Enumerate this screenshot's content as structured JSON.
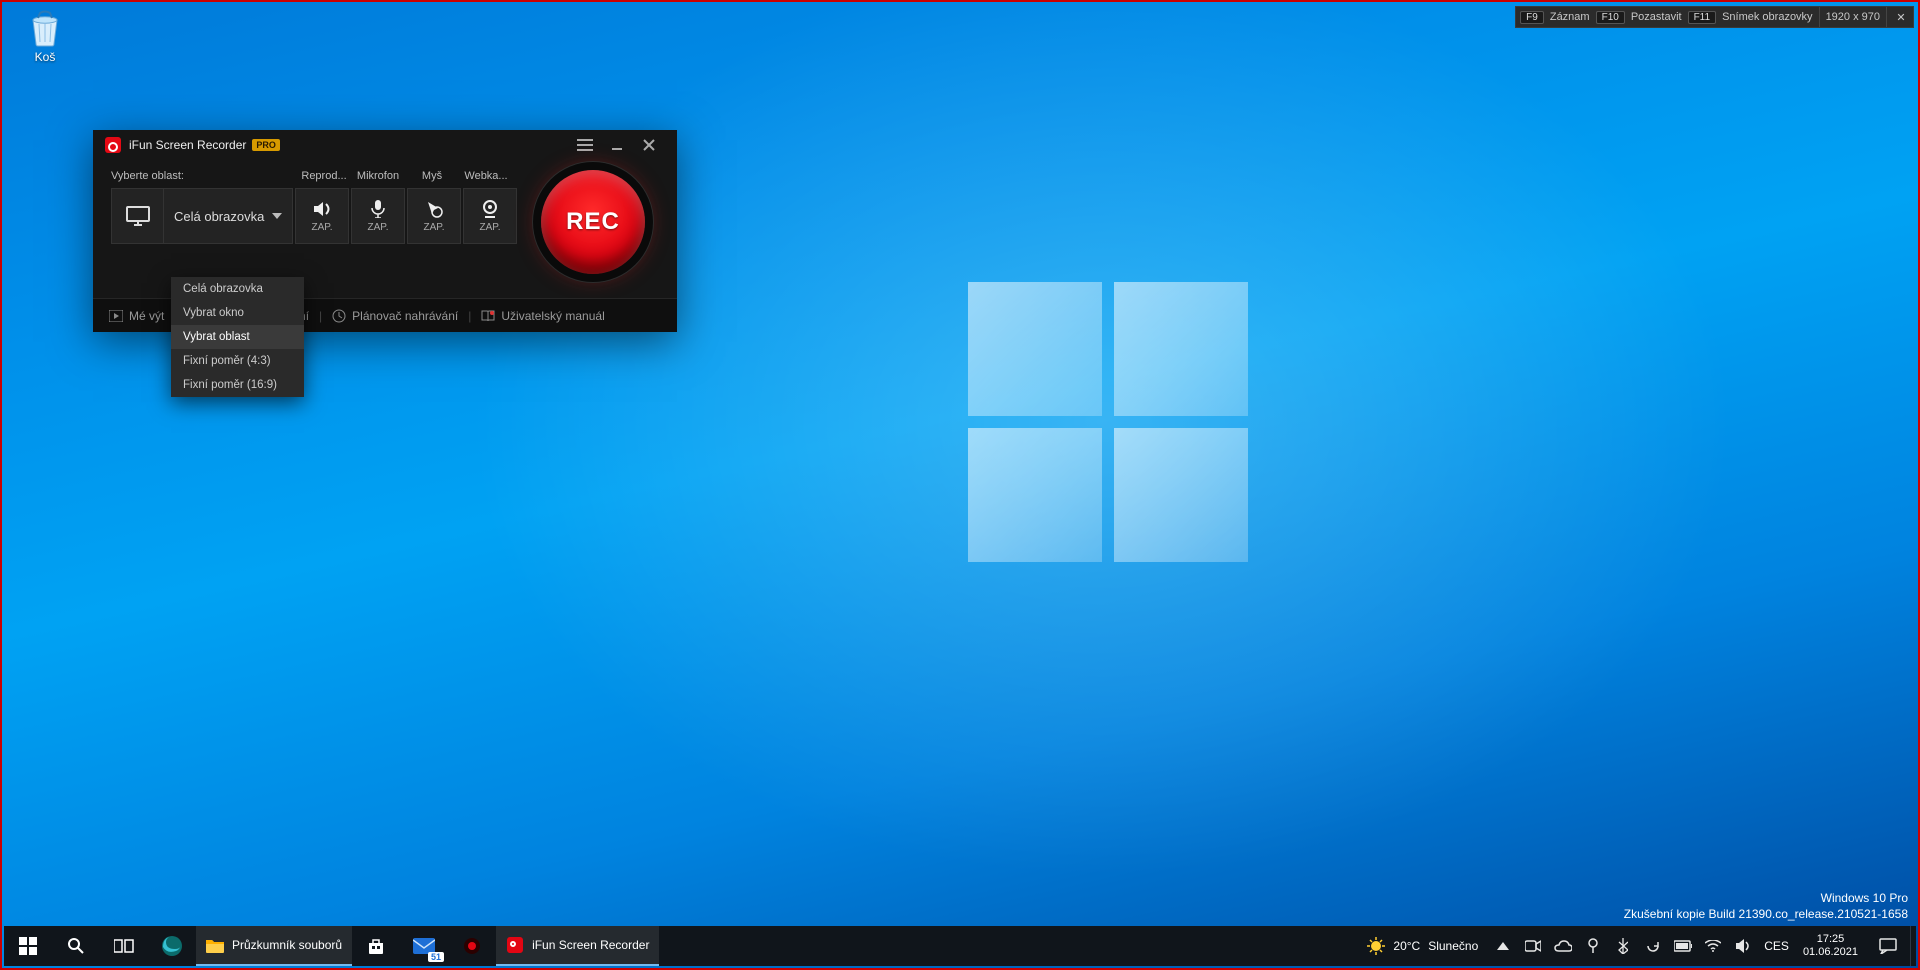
{
  "desktop": {
    "recycle_bin": "Koš"
  },
  "watermark": {
    "line1": "Windows 10 Pro",
    "line2": "Zkušební kopie Build 21390.co_release.210521-1658"
  },
  "overlay": {
    "k1": "F9",
    "l1": "Záznam",
    "k2": "F10",
    "l2": "Pozastavit",
    "k3": "F11",
    "l3": "Snímek obrazovky",
    "dim": "1920 x 970",
    "close": "✕"
  },
  "app": {
    "title": "iFun Screen Recorder",
    "pro": "PRO",
    "area_label": "Vyberte oblast:",
    "area_value": "Celá obrazovka",
    "cols": {
      "speaker": "Reprod...",
      "mic": "Mikrofon",
      "mouse": "Myš",
      "cam": "Webka..."
    },
    "state": "ZAP.",
    "rec": "REC",
    "footer": {
      "creations_tail": "ení",
      "creations_prefix": "Mé výt",
      "scheduler": "Plánovač nahrávání",
      "manual": "Uživatelský manuál"
    },
    "dropdown": [
      "Celá obrazovka",
      "Vybrat okno",
      "Vybrat oblast",
      "Fixní poměr (4:3)",
      "Fixní poměr (16:9)"
    ],
    "dropdown_hover_index": 2
  },
  "taskbar": {
    "explorer": "Průzkumník souborů",
    "ifun": "iFun Screen Recorder",
    "mail_badge": "51",
    "weather_temp": "20°C",
    "weather_text": "Slunečno",
    "lang": "CES",
    "time": "17:25",
    "date": "01.06.2021"
  }
}
